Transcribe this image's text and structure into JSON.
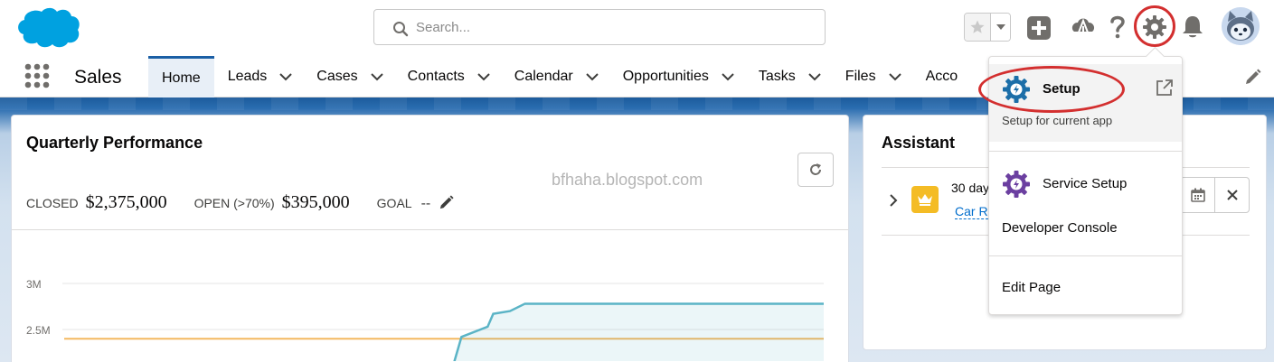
{
  "header": {
    "logo": "salesforce-cloud-logo",
    "search_placeholder": "Search...",
    "icons": [
      "star-icon",
      "chevron-down-icon",
      "plus-icon",
      "trailhead-icon",
      "help-icon",
      "gear-icon",
      "bell-icon",
      "avatar"
    ],
    "highlight_color": "#d32f2f"
  },
  "nav": {
    "app_name": "Sales",
    "items": [
      {
        "label": "Home",
        "active": true
      },
      {
        "label": "Leads"
      },
      {
        "label": "Cases"
      },
      {
        "label": "Contacts"
      },
      {
        "label": "Calendar"
      },
      {
        "label": "Opportunities"
      },
      {
        "label": "Tasks"
      },
      {
        "label": "Files"
      },
      {
        "label": "Acco"
      }
    ],
    "accent_color": "#1b5fa5"
  },
  "performance": {
    "title": "Quarterly Performance",
    "closed_label": "CLOSED",
    "closed_value": "$2,375,000",
    "open_label": "OPEN (>70%)",
    "open_value": "$395,000",
    "goal_label": "GOAL",
    "goal_value": "--"
  },
  "watermark": "bfhaha.blogspot.com",
  "chart_data": {
    "type": "line",
    "ytick_labels": [
      "3M",
      "2.5M"
    ],
    "goal_line": 2400000,
    "series": [
      {
        "color": "#5bb4c6",
        "points": [
          [
            0.0,
            2000000
          ],
          [
            0.03,
            2420000
          ],
          [
            0.1,
            2530000
          ],
          [
            0.115,
            2670000
          ],
          [
            0.16,
            2700000
          ],
          [
            0.2,
            2780000
          ],
          [
            1.0,
            2780000
          ]
        ]
      }
    ],
    "goal_color": "#f4b860",
    "ylim": [
      2000000,
      3100000
    ]
  },
  "assistant": {
    "title": "Assistant",
    "item_text": "30 day",
    "item_link": "Car R",
    "badge_icon": "crown-icon"
  },
  "dropdown": {
    "setup_label": "Setup",
    "setup_sub": "Setup for current app",
    "service_setup_label": "Service Setup",
    "developer_console_label": "Developer Console",
    "edit_page_label": "Edit Page"
  }
}
